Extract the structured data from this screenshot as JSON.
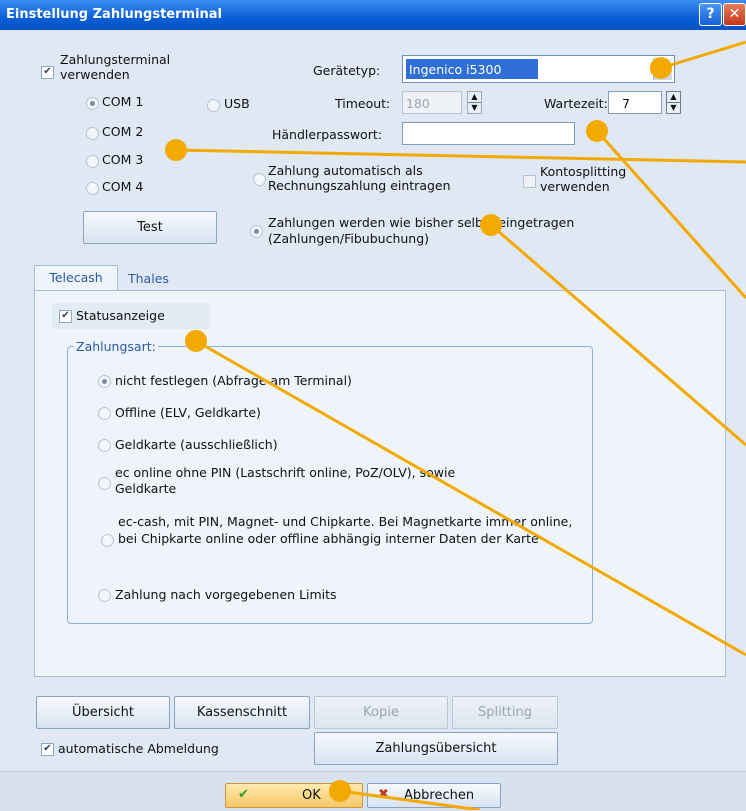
{
  "window": {
    "title": "Einstellung Zahlungsterminal"
  },
  "terminal": {
    "use_label": "Zahlungsterminal verwenden",
    "device_type_label": "Gerätetyp:",
    "device_type_value": "Ingenico i5300",
    "timeout_label": "Timeout:",
    "timeout_value": "180",
    "wait_label": "Wartezeit:",
    "wait_value": "7",
    "merchant_password_label": "Händlerpasswort:",
    "ports": [
      "COM 1",
      "COM 2",
      "COM 3",
      "COM 4"
    ],
    "usb_label": "USB",
    "test_button": "Test",
    "auto_invoice_label": "Zahlung automatisch als Rechnungszahlung eintragen",
    "account_splitting_label": "Kontosplitting verwenden",
    "manual_entry_label": "Zahlungen werden wie bisher selbst eingetragen (Zahlungen/Fibubuchung)"
  },
  "tabs": [
    "Telecash",
    "Thales"
  ],
  "telecash": {
    "status_label": "Statusanzeige",
    "payment_type_legend": "Zahlungsart:",
    "options": [
      "nicht festlegen (Abfrage am Terminal)",
      "Offline (ELV, Geldkarte)",
      "Geldkarte (ausschließlich)",
      "ec online ohne PIN (Lastschrift online, PoZ/OLV), sowie Geldkarte",
      "ec-cash, mit PIN, Magnet- und Chipkarte. Bei Magnetkarte immer online, bei Chipkarte online oder offline abhängig interner Daten der Karte",
      "Zahlung nach vorgegebenen Limits"
    ]
  },
  "bottom": {
    "overview": "Übersicht",
    "cash_cut": "Kassenschnitt",
    "copy": "Kopie",
    "splitting": "Splitting",
    "auto_logout": "automatische Abmeldung",
    "payment_overview": "Zahlungsübersicht",
    "ok": "OK",
    "cancel": "Abbrechen"
  },
  "colors": {
    "accent": "#f2a900",
    "titlebar": "#0a5fd6",
    "panel": "#eef4fa"
  }
}
